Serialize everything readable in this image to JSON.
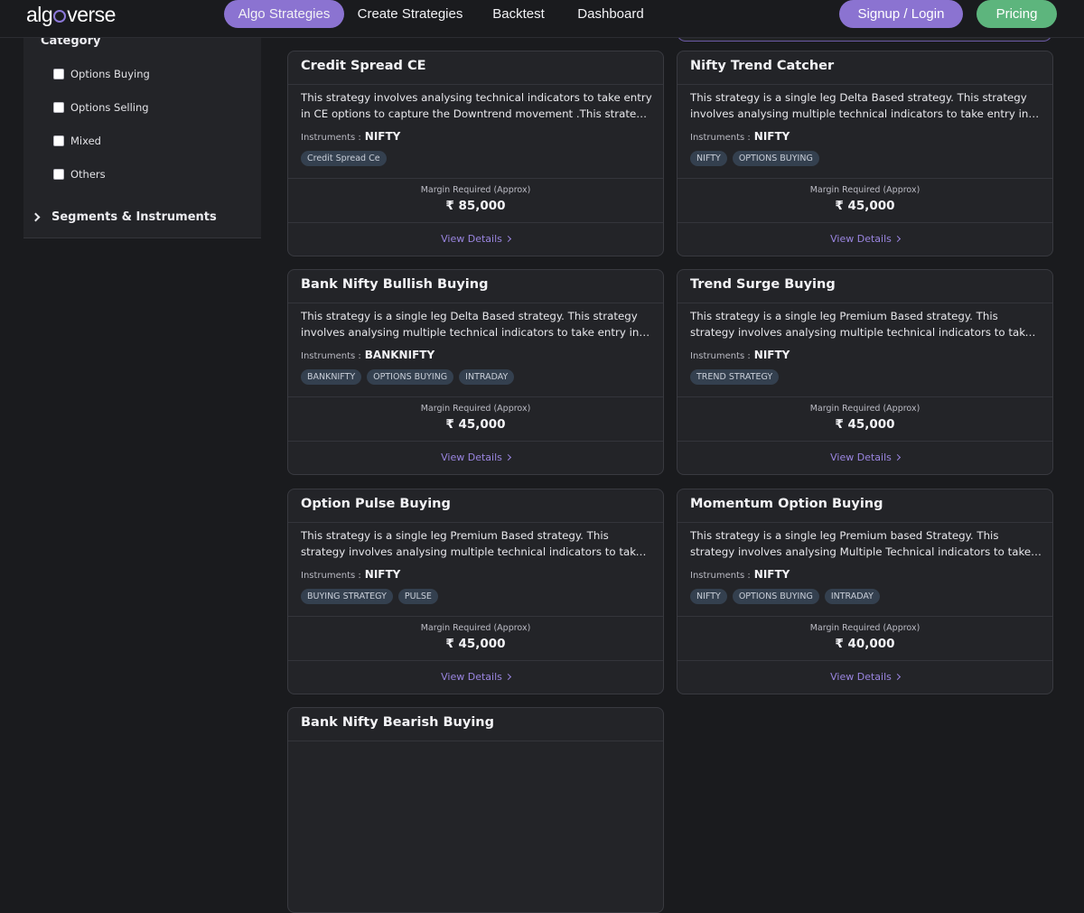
{
  "nav": {
    "logo": {
      "pre": "alg",
      "post": "verse"
    },
    "tabs": [
      {
        "label": "Algo Strategies",
        "active": true
      },
      {
        "label": "Create Strategies",
        "active": false
      },
      {
        "label": "Backtest",
        "active": false
      },
      {
        "label": "Dashboard",
        "active": false
      }
    ],
    "signup_label": "Signup / Login",
    "pricing_label": "Pricing"
  },
  "sidebar": {
    "category_title": "Category",
    "categories": [
      "Options Buying",
      "Options Selling",
      "Mixed",
      "Others"
    ],
    "segments_label": "Segments & Instruments"
  },
  "cards": [
    {
      "title": "Credit Spread CE",
      "description": "This strategy involves analysing technical indicators to take entry in CE options to capture the Downtrend movement .This strategy aims to profit from the price movement.",
      "instruments_label": "Instruments :",
      "instrument": "NIFTY",
      "tags": [
        "Credit Spread Ce"
      ],
      "margin_label": "Margin Required (Approx)",
      "margin": "₹ 85,000",
      "view_label": "View Details"
    },
    {
      "title": "Nifty Trend Catcher",
      "description": "This strategy is a single leg Delta Based strategy. This strategy involves analysing multiple technical indicators to take entry in options.",
      "instruments_label": "Instruments :",
      "instrument": "NIFTY",
      "tags": [
        "NIFTY",
        "OPTIONS BUYING"
      ],
      "margin_label": "Margin Required (Approx)",
      "margin": "₹ 45,000",
      "view_label": "View Details"
    },
    {
      "title": "Bank Nifty Bullish Buying",
      "description": "This strategy is a single leg Delta Based strategy. This strategy involves analysing multiple technical indicators to take entry in CE options.",
      "instruments_label": "Instruments :",
      "instrument": "BANKNIFTY",
      "tags": [
        "BANKNIFTY",
        "OPTIONS BUYING",
        "INTRADAY"
      ],
      "margin_label": "Margin Required (Approx)",
      "margin": "₹ 45,000",
      "view_label": "View Details"
    },
    {
      "title": "Trend Surge Buying",
      "description": "This strategy is a single leg Premium Based strategy. This strategy involves analysing multiple technical indicators to take entry in CE options.",
      "instruments_label": "Instruments :",
      "instrument": "NIFTY",
      "tags": [
        "TREND STRATEGY"
      ],
      "margin_label": "Margin Required (Approx)",
      "margin": "₹ 45,000",
      "view_label": "View Details"
    },
    {
      "title": "Option Pulse Buying",
      "description": "This strategy is a single leg Premium Based strategy. This strategy involves analysing multiple technical indicators to take entry in CE options.",
      "instruments_label": "Instruments :",
      "instrument": "NIFTY",
      "tags": [
        "BUYING STRATEGY",
        "PULSE"
      ],
      "margin_label": "Margin Required (Approx)",
      "margin": "₹ 45,000",
      "view_label": "View Details"
    },
    {
      "title": "Momentum Option Buying",
      "description": "This strategy is a single leg Premium based Strategy. This strategy involves analysing Multiple Technical indicators to take entry in options.",
      "instruments_label": "Instruments :",
      "instrument": "NIFTY",
      "tags": [
        "NIFTY",
        "OPTIONS BUYING",
        "INTRADAY"
      ],
      "margin_label": "Margin Required (Approx)",
      "margin": "₹ 40,000",
      "view_label": "View Details"
    },
    {
      "title": "Bank Nifty Bearish Buying"
    }
  ]
}
